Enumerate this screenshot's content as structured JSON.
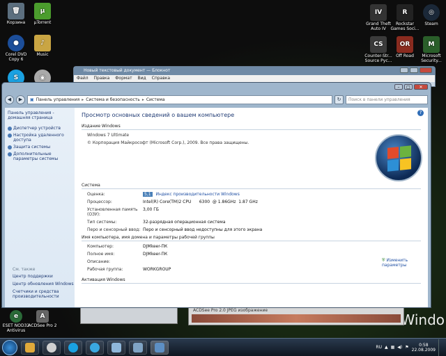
{
  "desktop": {
    "icons_left": [
      {
        "label": "Корзина",
        "color": "#5c6f7f",
        "glyph": "🗑"
      },
      {
        "label": "µTorrent",
        "color": "#4b9d2d",
        "glyph": "µ"
      },
      {
        "label": "Corel DVD Copy 6",
        "color": "#1c4e9a",
        "glyph": "●"
      },
      {
        "label": "Music",
        "color": "#c9a543",
        "glyph": "♪"
      },
      {
        "label": "Skype",
        "color": "#1aa1e1",
        "glyph": "S"
      },
      {
        "label": "",
        "color": "#aaaaaa",
        "glyph": "◉"
      }
    ],
    "icons_right": [
      {
        "label": "Grand Theft Auto IV",
        "color": "#333333",
        "glyph": "IV"
      },
      {
        "label": "Rockstar Games Soci...",
        "color": "#222222",
        "glyph": "R"
      },
      {
        "label": "Steam",
        "color": "#1b2838",
        "glyph": "◎"
      },
      {
        "label": "Counter-Str... Source Pyc...",
        "color": "#3b3b3b",
        "glyph": "CS"
      },
      {
        "label": "Off Road",
        "color": "#8a2b1f",
        "glyph": "OR"
      },
      {
        "label": "Microsoft Security...",
        "color": "#2a5e2a",
        "glyph": "M"
      }
    ],
    "icons_bottom": [
      {
        "label": "ESET NOD32 Antivirus",
        "color": "#2a6a38",
        "glyph": "e"
      },
      {
        "label": "ACDSee Pro 2",
        "color": "#666666",
        "glyph": "A"
      }
    ],
    "win7_text": "Windo"
  },
  "notepad": {
    "title": "Новый текстовый документ — Блокнот",
    "menu": [
      "Файл",
      "Правка",
      "Формат",
      "Вид",
      "Справка"
    ]
  },
  "acdsee": {
    "status": "ACDSee Pro 2.0 JPEG изображение"
  },
  "cp": {
    "breadcrumb": [
      "Панель управления",
      "Система и безопасность",
      "Система"
    ],
    "search_placeholder": "Поиск в панели управления",
    "sidebar": {
      "home": "Панель управления - домашняя страница",
      "items": [
        "Диспетчер устройств",
        "Настройка удаленного доступа",
        "Защита системы",
        "Дополнительные параметры системы"
      ],
      "see_also_title": "См. также",
      "see_also": [
        "Центр поддержки",
        "Центр обновления Windows",
        "Счетчики и средства производительности"
      ]
    },
    "heading": "Просмотр основных сведений о вашем компьютере",
    "edition": {
      "title": "Издание Windows",
      "name": "Windows 7 Ultimate",
      "copyright": "© Корпорация Майкрософт (Microsoft Corp.), 2009. Все права защищены."
    },
    "system": {
      "title": "Система",
      "rating_label": "Оценка:",
      "rating_badge": "5,1",
      "rating_link": "Индекс производительности Windows",
      "processor_label": "Процессор:",
      "processor_value": "Intel(R) Core(TM)2 CPU      6300  @ 1.86GHz  1.87 GHz",
      "ram_label": "Установленная память (ОЗУ):",
      "ram_value": "3,00 ГБ",
      "type_label": "Тип системы:",
      "type_value": "32-разрядная операционная система",
      "pen_label": "Перо и сенсорный ввод:",
      "pen_value": "Перо и сенсорный ввод недоступны для этого экрана"
    },
    "computer": {
      "title": "Имя компьютера, имя домена и параметры рабочей группы",
      "comp_label": "Компьютер:",
      "comp_value": "DJMkeer-ПК",
      "full_label": "Полное имя:",
      "full_value": "DJMkeer-ПК",
      "desc_label": "Описание:",
      "desc_value": "",
      "wg_label": "Рабочая группа:",
      "wg_value": "WORKGROUP",
      "change_link": "Изменить параметры"
    },
    "activation_title": "Активация Windows"
  },
  "taskbar": {
    "items": [
      {
        "name": "explorer",
        "color": "#e0a93a"
      },
      {
        "name": "media",
        "color": "#d0d0d0"
      },
      {
        "name": "skype",
        "color": "#1aa1e1"
      },
      {
        "name": "skype2",
        "color": "#3aa8e0"
      },
      {
        "name": "notepad",
        "color": "#8fb7da"
      },
      {
        "name": "acdsee",
        "color": "#7fa3c4"
      },
      {
        "name": "control-panel",
        "color": "#5d8fc3"
      }
    ],
    "lang": "RU",
    "time": "0:58",
    "date": "22.08.2009"
  }
}
